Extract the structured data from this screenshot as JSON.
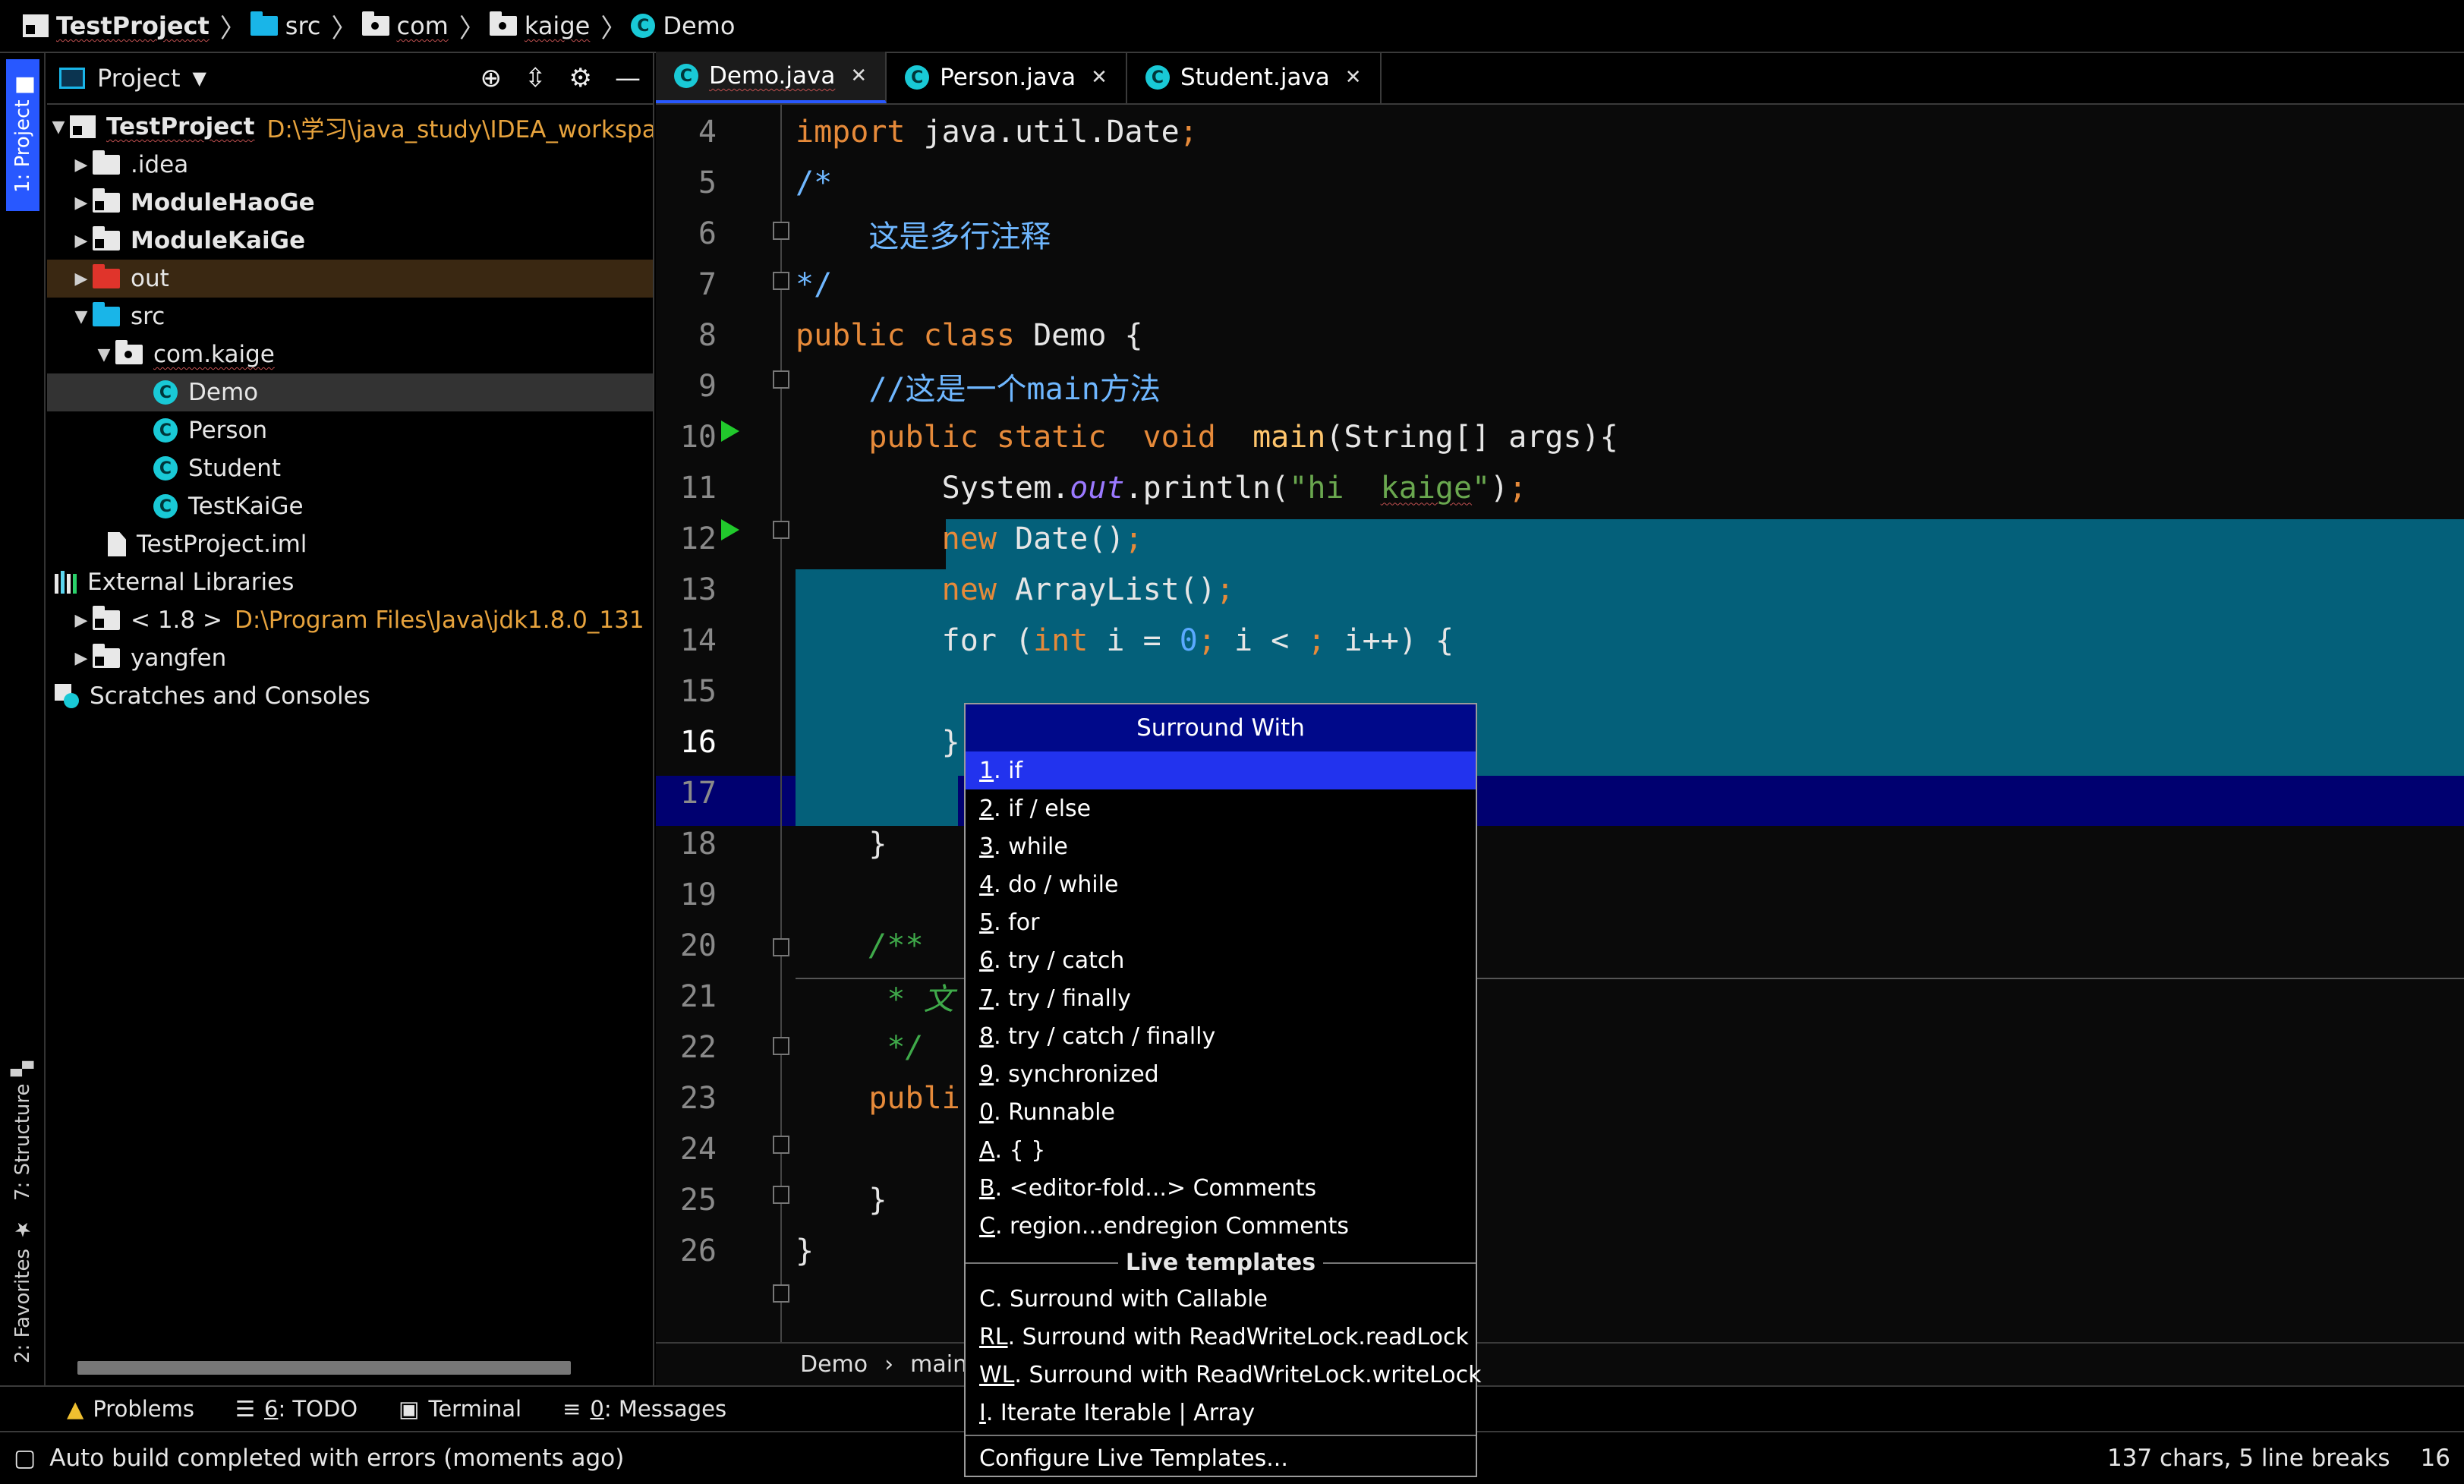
{
  "navbar": {
    "items": [
      "TestProject",
      "src",
      "com",
      "kaige",
      "Demo"
    ]
  },
  "left_strip": {
    "project_tab": "1: Project",
    "structure_tab": "7: Structure",
    "favorites_tab": "2: Favorites"
  },
  "project_panel": {
    "title": "Project",
    "tree": [
      {
        "label": "TestProject",
        "path": "D:\\学习\\java_study\\IDEA_workspace\\Te"
      },
      {
        "label": ".idea"
      },
      {
        "label": "ModuleHaoGe"
      },
      {
        "label": "ModuleKaiGe"
      },
      {
        "label": "out"
      },
      {
        "label": "src"
      },
      {
        "label": "com.kaige"
      },
      {
        "label": "Demo"
      },
      {
        "label": "Person"
      },
      {
        "label": "Student"
      },
      {
        "label": "TestKaiGe"
      },
      {
        "label": "TestProject.iml"
      },
      {
        "label": "External Libraries"
      },
      {
        "label": "< 1.8 >",
        "path": "D:\\Program Files\\Java\\jdk1.8.0_131"
      },
      {
        "label": "yangfen"
      },
      {
        "label": "Scratches and Consoles"
      }
    ]
  },
  "editor": {
    "tabs": [
      "Demo.java",
      "Person.java",
      "Student.java"
    ],
    "line_numbers": [
      "4",
      "5",
      "6",
      "7",
      "8",
      "9",
      "10",
      "11",
      "12",
      "13",
      "14",
      "15",
      "16",
      "17",
      "18",
      "19",
      "20",
      "21",
      "22",
      "23",
      "24",
      "25",
      "26"
    ],
    "breadcrumb": [
      "Demo",
      "main"
    ]
  },
  "popup": {
    "title": "Surround With",
    "items": [
      {
        "key": "1",
        "label": ". if"
      },
      {
        "key": "2",
        "label": ". if / else"
      },
      {
        "key": "3",
        "label": ". while"
      },
      {
        "key": "4",
        "label": ". do / while"
      },
      {
        "key": "5",
        "label": ". for"
      },
      {
        "key": "6",
        "label": ". try / catch"
      },
      {
        "key": "7",
        "label": ". try / finally"
      },
      {
        "key": "8",
        "label": ". try / catch / finally"
      },
      {
        "key": "9",
        "label": ". synchronized"
      },
      {
        "key": "0",
        "label": ". Runnable"
      },
      {
        "key": "A",
        "label": ". { }"
      },
      {
        "key": "B",
        "label": ". <editor-fold...> Comments"
      },
      {
        "key": "C",
        "label": ". region...endregion Comments"
      }
    ],
    "live_templates_header": "Live templates",
    "live_templates": [
      {
        "key": "C",
        "label": " . Surround with Callable"
      },
      {
        "key": "RL",
        "label": ". Surround with ReadWriteLock.readLock"
      },
      {
        "key": "WL",
        "label": ". Surround with ReadWriteLock.writeLock"
      },
      {
        "key": "I",
        "label": ". Iterate Iterable | Array"
      }
    ],
    "configure": "Configure Live Templates..."
  },
  "bottom_toolbar": {
    "problems": "Problems",
    "todo_key": "6",
    "todo": ": TODO",
    "terminal": "Terminal",
    "messages_key": "0",
    "messages": ": Messages"
  },
  "status": {
    "message": "Auto build completed with errors (moments ago)",
    "chars": "137 chars, 5 line breaks",
    "extra": "16"
  },
  "colors": {
    "selection": "#04607a",
    "caret_line": "#000070",
    "accent": "#2858ff",
    "popup_title": "#00098a"
  }
}
